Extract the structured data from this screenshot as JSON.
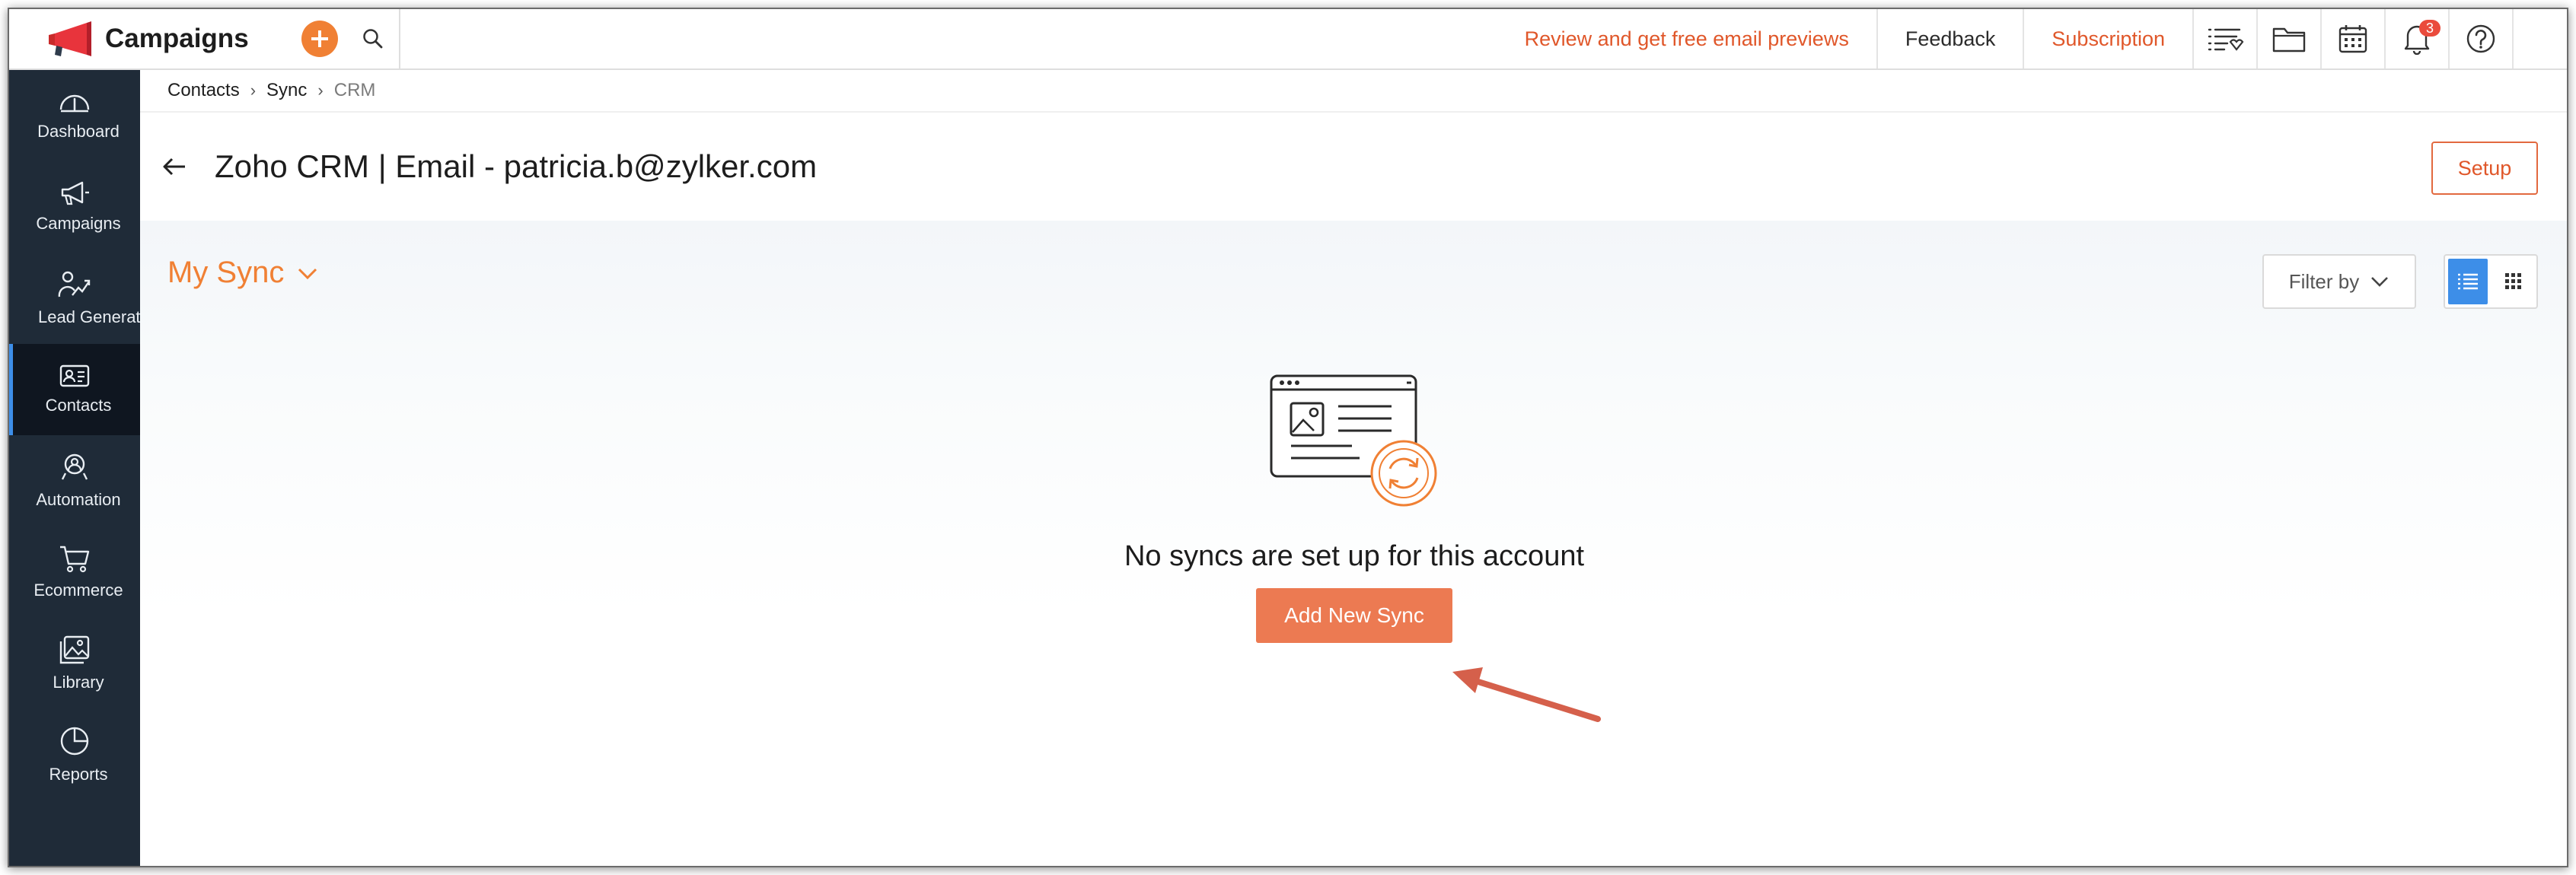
{
  "app": {
    "name": "Campaigns"
  },
  "topbar": {
    "links": [
      {
        "id": "review",
        "label": "Review and get free email previews"
      },
      {
        "id": "feedback",
        "label": "Feedback"
      },
      {
        "id": "subscription",
        "label": "Subscription"
      }
    ],
    "icons": [
      "list-filter-icon",
      "folder-icon",
      "calendar-icon",
      "bell-icon",
      "help-icon"
    ],
    "notifications_count": "3"
  },
  "sidebar": {
    "items": [
      {
        "label": "Dashboard",
        "icon": "dashboard-gauge-icon",
        "active": false
      },
      {
        "label": "Campaigns",
        "icon": "megaphone-icon",
        "active": false
      },
      {
        "label": "Lead Generation",
        "icon": "lead-generation-icon",
        "active": false
      },
      {
        "label": "Contacts",
        "icon": "contact-card-icon",
        "active": true
      },
      {
        "label": "Automation",
        "icon": "automation-icon",
        "active": false
      },
      {
        "label": "Ecommerce",
        "icon": "cart-icon",
        "active": false
      },
      {
        "label": "Library",
        "icon": "image-library-icon",
        "active": false
      },
      {
        "label": "Reports",
        "icon": "pie-chart-icon",
        "active": false
      }
    ]
  },
  "breadcrumb": {
    "items": [
      "Contacts",
      "Sync",
      "CRM"
    ]
  },
  "header": {
    "title": "Zoho CRM | Email - patricia.b@zylker.com",
    "setup_label": "Setup"
  },
  "content": {
    "sync_selector": "My Sync",
    "filter_label": "Filter by",
    "empty_message": "No syncs are set up for this account",
    "add_button_label": "Add New Sync"
  },
  "colors": {
    "accent": "#f08034",
    "sidebar_bg": "#1f2b38",
    "active_blue": "#3d8ee8",
    "button": "#ec7a52"
  }
}
